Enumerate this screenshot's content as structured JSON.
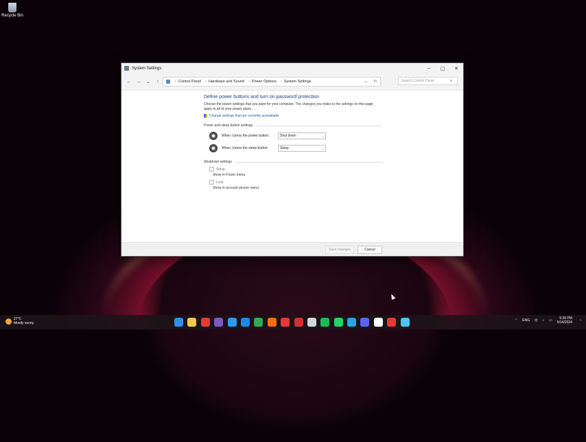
{
  "desktop": {
    "recycle_bin_label": "Recycle Bin"
  },
  "window": {
    "title": "System Settings",
    "controls": {
      "minimize": "–",
      "maximize": "▢",
      "close": "✕"
    },
    "nav": {
      "back": "←",
      "forward": "→",
      "recent": "⌄",
      "up": "↑"
    },
    "breadcrumb": [
      "Control Panel",
      "Hardware and Sound",
      "Power Options",
      "System Settings"
    ],
    "address_dropdown": "⌄",
    "refresh": "↻",
    "search_placeholder": "Search Control Panel",
    "search_icon": "⌕"
  },
  "content": {
    "heading": "Define power buttons and turn on password protection",
    "description": "Choose the power settings that you want for your computer. The changes you make to the settings on this page apply to all of your power plans.",
    "change_link": "Change settings that are currently unavailable",
    "power_sleep_section": "Power and sleep button settings",
    "power_button": {
      "label": "When I press the power button:",
      "value": "Shut down"
    },
    "sleep_button": {
      "label": "When I press the sleep button:",
      "value": "Sleep"
    },
    "shutdown_section": "Shutdown settings",
    "shutdown_options": [
      {
        "label": "Sleep",
        "sub": "Show in Power menu."
      },
      {
        "label": "Lock",
        "sub": "Show in account picture menu."
      }
    ]
  },
  "footer": {
    "save_label": "Save changes",
    "cancel_label": "Cancel"
  },
  "taskbar": {
    "weather_temp": "27°C",
    "weather_desc": "Mostly sunny",
    "icon_colors": [
      "#2f8fe8",
      "#f2c94c",
      "#e53935",
      "#7e57c2",
      "#2b9af3",
      "#1e88e5",
      "#34a853",
      "#ff6d00",
      "#e53935",
      "#d32f2f",
      "#cfd8dc",
      "#1db954",
      "#25d366",
      "#2aa3e0",
      "#5865f2",
      "#ffffff",
      "#e53935",
      "#4fc3f7"
    ],
    "lang": "ENG",
    "time": "5:39 PM",
    "date": "5/14/2024"
  }
}
